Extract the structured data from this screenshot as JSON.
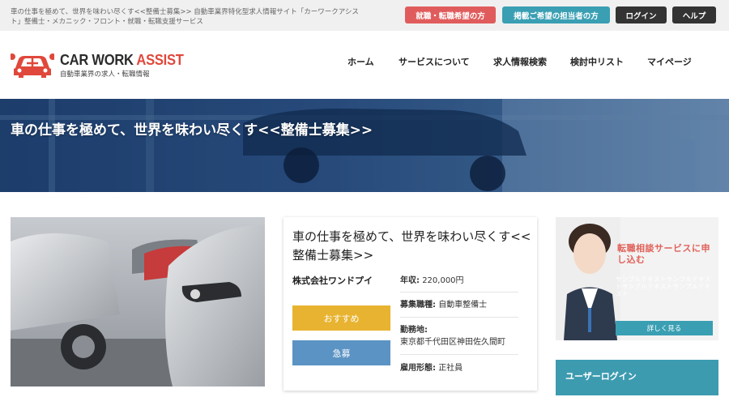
{
  "topbar": {
    "description": "車の仕事を極めて、世界を味わい尽くす<<整備士募集>> 自動車業界特化型求人情報サイト「カーワークアシスト」整備士・メカニック・フロント・就職・転職支援サービス",
    "buttons": {
      "job_seeker": "就職・転職希望の方",
      "advertiser": "掲載ご希望の担当者の方",
      "login": "ログイン",
      "help": "ヘルプ"
    }
  },
  "logo": {
    "name_main": "CAR WORK",
    "name_accent": "ASSIST",
    "tagline": "自動車業界の求人・転職情報"
  },
  "nav": {
    "home": "ホーム",
    "services": "サービスについて",
    "job_search": "求人情報検索",
    "shortlist": "検討中リスト",
    "mypage": "マイページ"
  },
  "hero": {
    "title": "車の仕事を極めて、世界を味わい尽くす<<整備士募集>>"
  },
  "job": {
    "title": "車の仕事を極めて、世界を味わい尽くす<<整備士募集>>",
    "company": "株式会社ワンドプイ",
    "recommend_label": "おすすめ",
    "urgent_label": "急募",
    "salary_key": "年収:",
    "salary_value": "220,000円",
    "position_key": "募集職種:",
    "position_value": "自動車整備士",
    "location_key": "勤務地:",
    "location_value": "東京都千代田区神田佐久間町",
    "employment_key": "雇用形態:",
    "employment_value": "正社員"
  },
  "sidebar": {
    "ad_title": "転職相談サービスに申し込む",
    "ad_sample": "サンプルテキストサンプルテキストサンプルテキストサンプルテキスト",
    "ad_button": "詳しく見る",
    "login_title": "ユーザーログイン"
  },
  "colors": {
    "accent_red": "#e05c5c",
    "accent_teal": "#3a9fb3",
    "recommend": "#e8b330",
    "urgent": "#5b93c4"
  }
}
